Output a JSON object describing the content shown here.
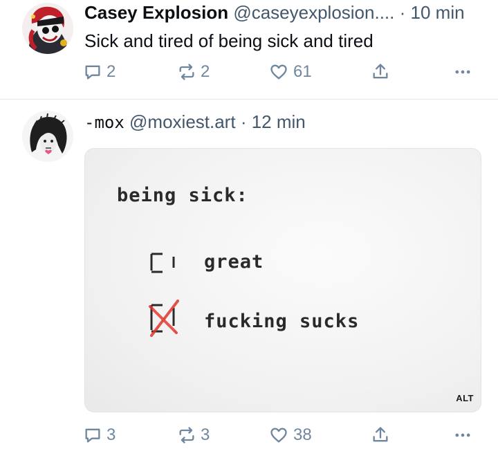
{
  "posts": [
    {
      "author": {
        "display_name": "Casey Explosion",
        "handle": "@caseyexplosion....",
        "avatar_icon": "avatar-cartoon-portrait"
      },
      "separator": "·",
      "time": "10 min",
      "text": "Sick and tired of being sick and tired",
      "stats": {
        "replies": "2",
        "reposts": "2",
        "likes": "61"
      }
    },
    {
      "author": {
        "display_name": "-mox",
        "handle": "@moxiest.art",
        "avatar_icon": "avatar-sketch-portrait"
      },
      "separator": "·",
      "time": "12 min",
      "image": {
        "heading": "being sick:",
        "option_1": "great",
        "option_2": "fucking sucks",
        "alt_badge": "ALT"
      },
      "stats": {
        "replies": "3",
        "reposts": "3",
        "likes": "38"
      }
    }
  ],
  "icons": {
    "reply": "reply-icon",
    "repost": "repost-icon",
    "like": "heart-icon",
    "share": "share-icon",
    "more": "more-icon"
  },
  "colors": {
    "text": "#0b0f14",
    "muted": "#42576c",
    "icon": "#6f869f",
    "divider": "#e3e8ee",
    "check_mark": "#e0342a"
  }
}
